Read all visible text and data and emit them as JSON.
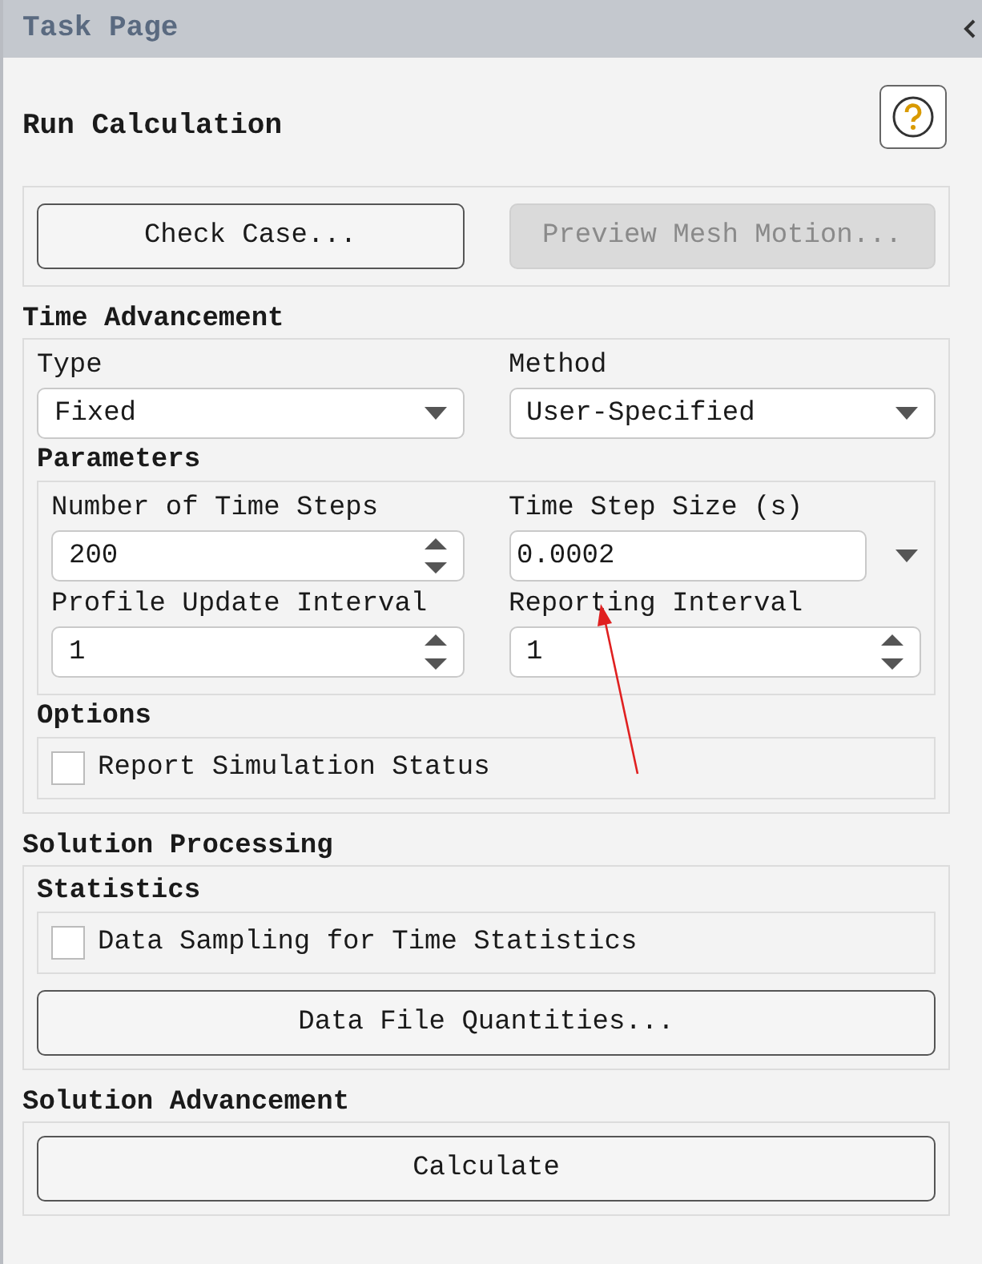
{
  "title_bar": {
    "title": "Task Page"
  },
  "heading": "Run Calculation",
  "top_buttons": [
    {
      "label": "Check Case...",
      "disabled": false
    },
    {
      "label": "Preview Mesh Motion...",
      "disabled": true
    }
  ],
  "time_advancement": {
    "heading": "Time Advancement",
    "selects": [
      {
        "label": "Type",
        "value": "Fixed"
      },
      {
        "label": "Method",
        "value": "User-Specified"
      }
    ],
    "parameters": {
      "heading": "Parameters",
      "fields": [
        {
          "label": "Number of Time Steps",
          "value": "200",
          "kind": "spinner"
        },
        {
          "label": "Time Step Size (s)",
          "value": "0.0002",
          "kind": "unit"
        },
        {
          "label": "Profile Update Interval",
          "value": "1",
          "kind": "spinner"
        },
        {
          "label": "Reporting Interval",
          "value": "1",
          "kind": "spinner"
        }
      ]
    },
    "options": {
      "heading": "Options",
      "checkboxes": [
        {
          "label": "Report Simulation Status",
          "checked": false
        }
      ]
    }
  },
  "solution_processing": {
    "heading": "Solution Processing",
    "statistics": {
      "heading": "Statistics",
      "checkboxes": [
        {
          "label": "Data Sampling for Time Statistics",
          "checked": false
        }
      ]
    },
    "button": "Data File Quantities..."
  },
  "solution_advancement": {
    "heading": "Solution Advancement",
    "button": "Calculate"
  }
}
